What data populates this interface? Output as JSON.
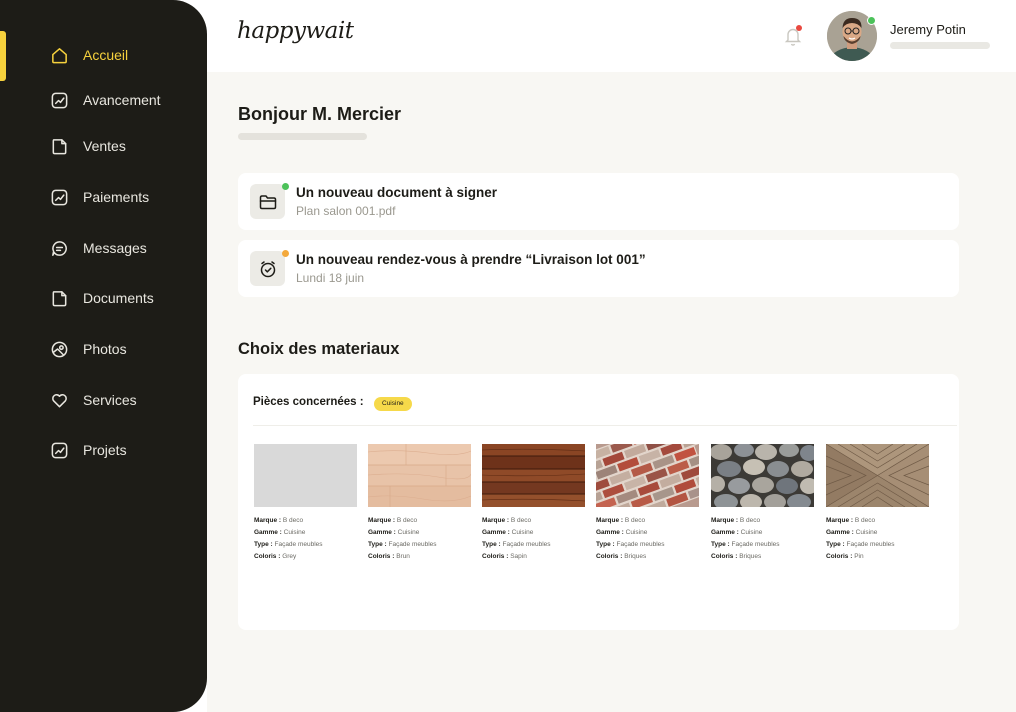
{
  "app": {
    "logo_text": "happywait"
  },
  "colors": {
    "sidebar_bg": "#1d1c17",
    "accent": "#f6d13d",
    "online": "#4cc25a",
    "alert": "#e9483f",
    "pending": "#f3a93c"
  },
  "sidebar": {
    "items": [
      {
        "label": "Accueil",
        "icon": "home-icon",
        "active": true
      },
      {
        "label": "Avancement",
        "icon": "chart-icon"
      },
      {
        "label": "Ventes",
        "icon": "document-icon"
      },
      {
        "label": "Paiements",
        "icon": "chart-icon"
      },
      {
        "label": "Messages",
        "icon": "chat-icon"
      },
      {
        "label": "Documents",
        "icon": "document-icon"
      },
      {
        "label": "Photos",
        "icon": "photo-icon"
      },
      {
        "label": "Services",
        "icon": "heart-icon"
      },
      {
        "label": "Projets",
        "icon": "chart-icon"
      }
    ]
  },
  "header": {
    "user": {
      "name": "Jeremy Potin",
      "online": true
    },
    "notifications_icon": "bell-icon"
  },
  "main": {
    "greeting": "Bonjour M. Mercier",
    "notifications": [
      {
        "title": "Un nouveau document à signer",
        "subtitle": "Plan salon 001.pdf",
        "icon": "folder-icon",
        "status_color": "#4cc25a"
      },
      {
        "title": "Un nouveau rendez-vous à prendre “Livraison lot 001”",
        "subtitle": "Lundi 18 juin",
        "icon": "clock-icon",
        "status_color": "#f3a93c"
      }
    ],
    "materials": {
      "section_title": "Choix des materiaux",
      "rooms_label": "Pièces concernées :",
      "room_tag": "Cuisine",
      "field_labels": {
        "brand": "Marque :",
        "range": "Gamme :",
        "type": "Type :",
        "color": "Coloris :"
      },
      "items": [
        {
          "brand": "B deco",
          "range": "Cuisine",
          "type": "Façade meubles",
          "color": "Grey"
        },
        {
          "brand": "B deco",
          "range": "Cuisine",
          "type": "Façade meubles",
          "color": "Brun"
        },
        {
          "brand": "B deco",
          "range": "Cuisine",
          "type": "Façade meubles",
          "color": "Sapin"
        },
        {
          "brand": "B deco",
          "range": "Cuisine",
          "type": "Façade meubles",
          "color": "Briques"
        },
        {
          "brand": "B deco",
          "range": "Cuisine",
          "type": "Façade meubles",
          "color": "Briques"
        },
        {
          "brand": "B deco",
          "range": "Cuisine",
          "type": "Façade meubles",
          "color": "Pin"
        }
      ]
    }
  }
}
